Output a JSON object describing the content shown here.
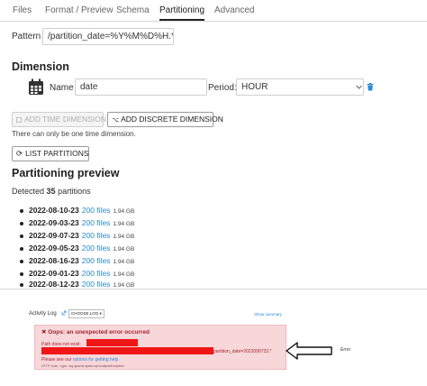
{
  "tabs": [
    {
      "label": "Files"
    },
    {
      "label": "Format / Preview"
    },
    {
      "label": "Schema"
    },
    {
      "label": "Partitioning",
      "active": true
    },
    {
      "label": "Advanced"
    }
  ],
  "pattern": {
    "label": "Pattern :",
    "value": "/partition_date=%Y%M%D%H.*/.*"
  },
  "dimension": {
    "heading": "Dimension",
    "name_label": "Name :",
    "name_value": "date",
    "period_label": "Period:",
    "period_value": "HOUR"
  },
  "buttons": {
    "add_time": "ADD TIME DIMENSION",
    "add_discrete": "ADD DISCRETE DIMENSION",
    "note": "There can only be one time dimension.",
    "list_partitions": "LIST PARTITIONS"
  },
  "preview": {
    "heading": "Partitioning preview",
    "detected_prefix": "Detected",
    "detected_count": "35",
    "detected_suffix": "partitions",
    "rows": [
      {
        "date": "2022-08-10-23",
        "files": "200 files",
        "size": "1.94 GB"
      },
      {
        "date": "2022-09-03-23",
        "files": "200 files",
        "size": "1.94 GB"
      },
      {
        "date": "2022-09-07-23",
        "files": "200 files",
        "size": "1.94 GB"
      },
      {
        "date": "2022-09-05-23",
        "files": "200 files",
        "size": "1.94 GB"
      },
      {
        "date": "2022-08-16-23",
        "files": "200 files",
        "size": "1.94 GB"
      },
      {
        "date": "2022-09-01-23",
        "files": "200 files",
        "size": "1.94 GB"
      },
      {
        "date": "2022-08-12-23",
        "files": "200 files",
        "size": "1.94 GB"
      }
    ]
  },
  "activity": {
    "title": "Activity Log",
    "choose_log": "CHOOSE LOG ▾",
    "show_summary": "Show summary",
    "error_title": "Oops: an unexpected error occurred",
    "path_prefix": "Path does not exist:",
    "path_suffix": "partition_date=2022090723.*",
    "help_prefix": "Please see our",
    "help_link": "options for getting help",
    "http_detail": "HTTP code: , type: org.apache.spark.sql.AnalysisException",
    "error_label": "Error"
  },
  "colors": {
    "link": "#2b8bd6",
    "error_bg": "#f8d7da",
    "error_text": "#a32430",
    "redaction": "#f01616"
  }
}
